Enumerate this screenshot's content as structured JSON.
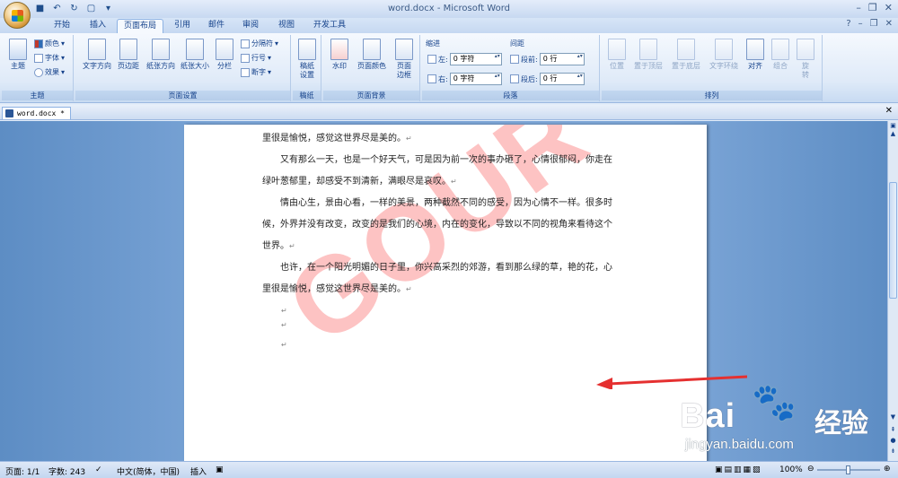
{
  "window": {
    "title": "word.docx - Microsoft Word"
  },
  "tabs": [
    "开始",
    "插入",
    "页面布局",
    "引用",
    "邮件",
    "审阅",
    "视图",
    "开发工具"
  ],
  "active_tab": "页面布局",
  "ribbon": {
    "theme": {
      "big": "主题",
      "colors": "颜色",
      "fonts": "字体",
      "effects": "效果",
      "label": "主题"
    },
    "page_setup": {
      "text_dir": "文字方向",
      "margins": "页边距",
      "orientation": "纸张方向",
      "size": "纸张大小",
      "columns": "分栏",
      "breaks": "分隔符",
      "line_numbers": "行号",
      "hyphenation": "断字",
      "label": "页面设置"
    },
    "manuscript": {
      "btn": "稿纸\n设置",
      "label": "稿纸"
    },
    "page_bg": {
      "watermark": "水印",
      "page_color": "页面颜色",
      "page_border": "页面\n边框",
      "label": "页面背景"
    },
    "paragraph": {
      "indent": "缩进",
      "left": "左:",
      "right": "右:",
      "left_val": "0 字符",
      "right_val": "0 字符",
      "spacing": "间距",
      "before": "段前:",
      "after": "段后:",
      "before_val": "0 行",
      "after_val": "0 行",
      "label": "段落"
    },
    "arrange": {
      "position": "位置",
      "bring_front": "置于顶层",
      "send_back": "置于底层",
      "wrap": "文字环绕",
      "align": "对齐",
      "group": "组合",
      "rotate": "旋\n转",
      "label": "排列"
    }
  },
  "document": {
    "tab_name": "word.docx *",
    "paragraphs": [
      "里很是愉悦，感觉这世界尽是美的。",
      "又有那么一天，也是一个好天气，可是因为前一次的事办砸了，心情很郁闷，你走在",
      "绿叶葱郁里，却感受不到清新，满眼尽是哀叹。",
      "情由心生，景由心看，一样的美景，两种截然不同的感受，因为心情不一样。很多时",
      "候，外界并没有改变，改变的是我们的心境，内在的变化，导致以不同的视角来看待这个",
      "世界。",
      "也许，在一个阳光明媚的日子里，你兴高采烈的郊游，看到那么绿的草，艳的花，心",
      "里很是愉悦，感觉这世界尽是美的。"
    ],
    "watermark_text": "GOUR",
    "watermark_color": "#fdb9b9"
  },
  "overlay": {
    "brand": "Bai",
    "brand_cn": "经验",
    "url": "jingyan.baidu.com",
    "arrow_color": "#e53030"
  },
  "status": {
    "page": "页面: 1/1",
    "words": "字数: 243",
    "lang": "中文(简体，中国)",
    "mode": "插入",
    "zoom": "100%"
  }
}
